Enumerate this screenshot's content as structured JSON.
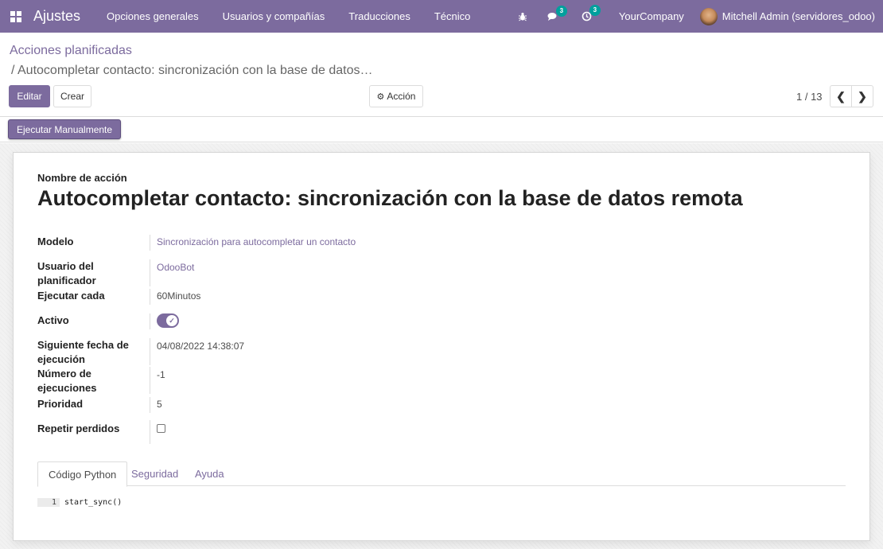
{
  "navbar": {
    "brand": "Ajustes",
    "menu": [
      "Opciones generales",
      "Usuarios y compañías",
      "Traducciones",
      "Técnico"
    ],
    "messages_badge": "3",
    "activities_badge": "3",
    "company": "YourCompany",
    "user": "Mitchell Admin (servidores_odoo)"
  },
  "breadcrumb": {
    "parent": "Acciones planificadas",
    "current": "/ Autocompletar contacto: sincronización con la base de datos…"
  },
  "buttons": {
    "edit": "Editar",
    "create": "Crear",
    "action": "Acción",
    "run_manually": "Ejecutar Manualmente"
  },
  "pager": {
    "value": "1 / 13"
  },
  "form": {
    "name_label": "Nombre de acción",
    "name": "Autocompletar contacto: sincronización con la base de datos remota",
    "fields": {
      "model": {
        "label": "Modelo",
        "value": "Sincronización para autocompletar un contacto"
      },
      "scheduler_user": {
        "label": "Usuario del planificador",
        "value": "OdooBot"
      },
      "interval": {
        "label": "Ejecutar cada",
        "value": "60Minutos"
      },
      "active": {
        "label": "Activo",
        "value": true
      },
      "nextcall": {
        "label": "Siguiente fecha de ejecución",
        "value": "04/08/2022 14:38:07"
      },
      "numbercall": {
        "label": "Número de ejecuciones",
        "value": "-1"
      },
      "priority": {
        "label": "Prioridad",
        "value": "5"
      },
      "doall": {
        "label": "Repetir perdidos",
        "value": false
      }
    },
    "tabs": [
      "Código Python",
      "Seguridad",
      "Ayuda"
    ],
    "active_tab": "Código Python",
    "code": {
      "line_number": "1",
      "line": "start_sync()"
    }
  },
  "colors": {
    "brand": "#7c6b9e",
    "badge": "#00a09d"
  }
}
